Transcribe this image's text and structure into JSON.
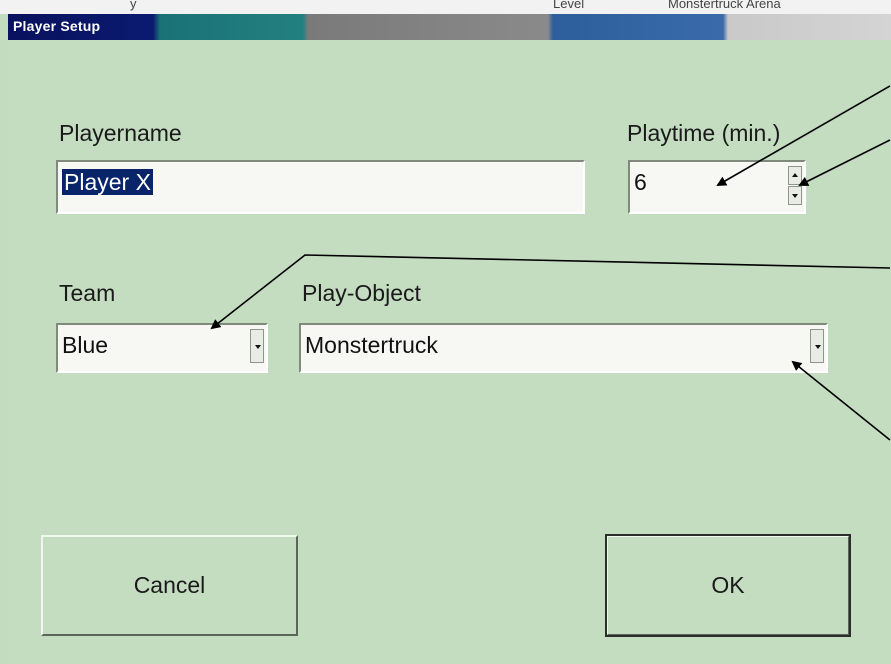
{
  "background_strip": {
    "left_text": "y",
    "mid_text": "Level",
    "right_text": "Monstertruck Arena"
  },
  "window": {
    "title": "Player Setup"
  },
  "playername": {
    "label": "Playername",
    "value": "Player X"
  },
  "playtime": {
    "label": "Playtime (min.)",
    "value": "6"
  },
  "team": {
    "label": "Team",
    "value": "Blue"
  },
  "play_object": {
    "label": "Play-Object",
    "value": "Monstertruck"
  },
  "buttons": {
    "cancel": "Cancel",
    "ok": "OK"
  },
  "colors": {
    "dialog_bg": "#c4ddc1",
    "selection": "#0a246a",
    "field_bg": "#f7f8f4"
  }
}
